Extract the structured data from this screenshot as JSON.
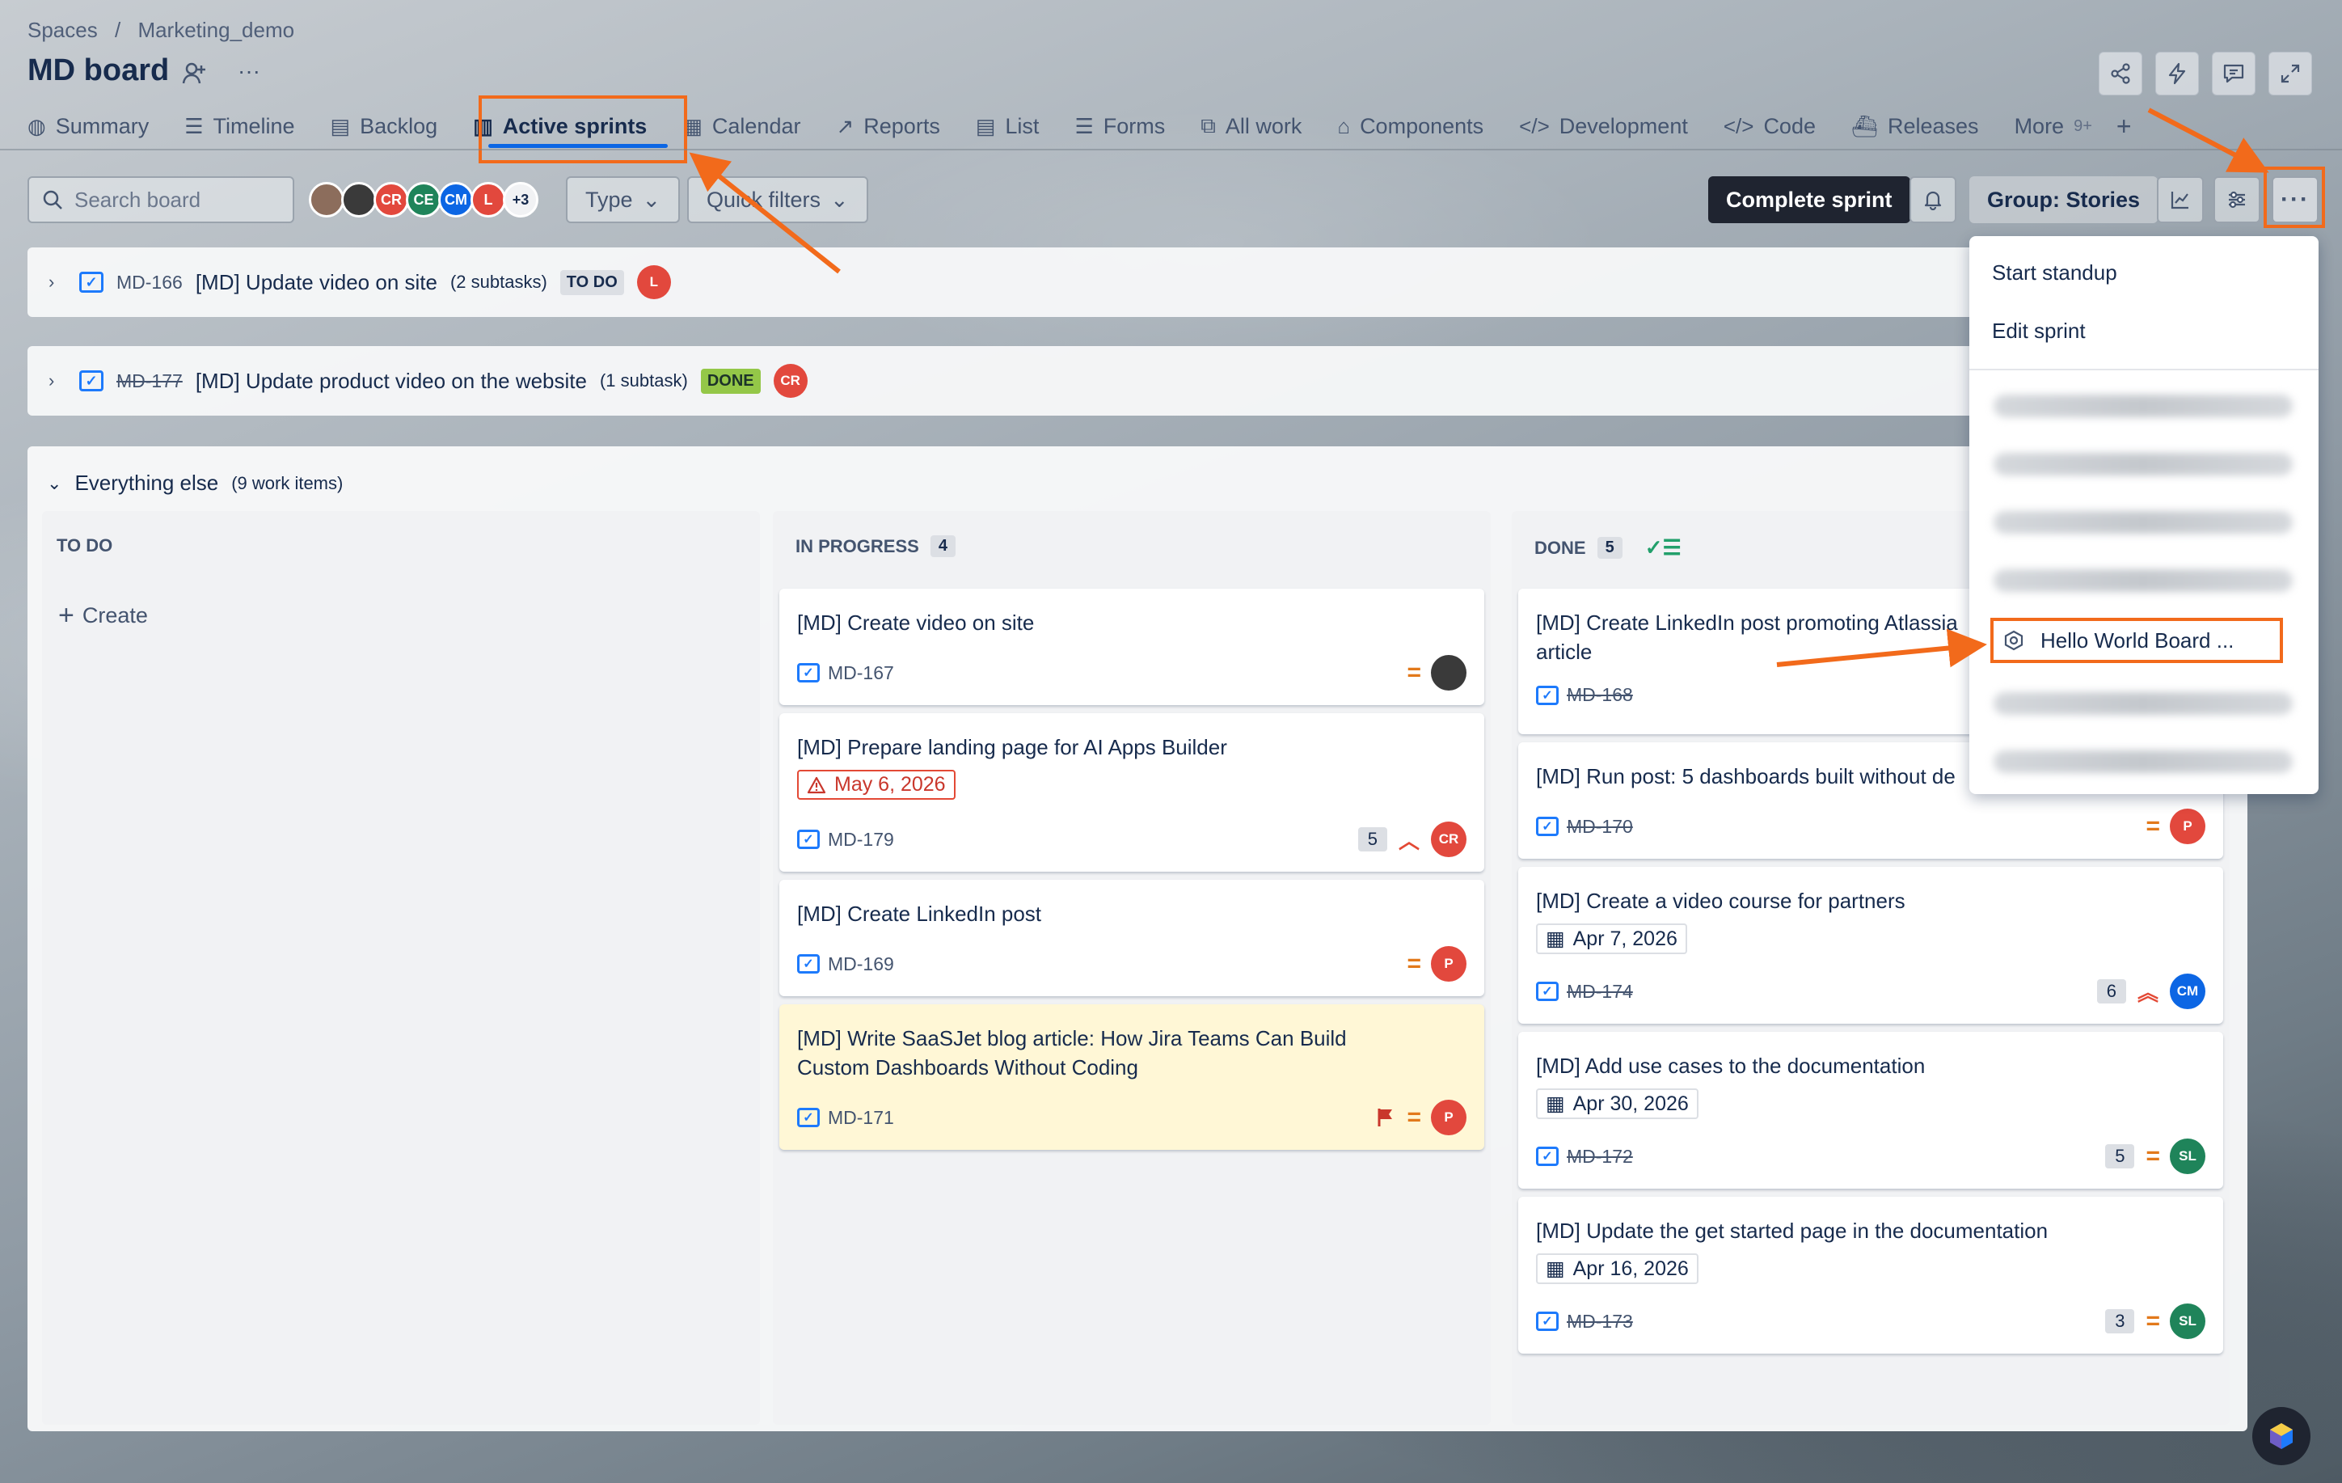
{
  "breadcrumb": {
    "spaces": "Spaces",
    "sep": "/",
    "project": "Marketing_demo"
  },
  "board_title": "MD board",
  "tabs": [
    {
      "label": "Summary",
      "icon": "globe-icon"
    },
    {
      "label": "Timeline",
      "icon": "timeline-icon"
    },
    {
      "label": "Backlog",
      "icon": "backlog-icon"
    },
    {
      "label": "Active sprints",
      "icon": "board-icon"
    },
    {
      "label": "Calendar",
      "icon": "calendar-icon"
    },
    {
      "label": "Reports",
      "icon": "chart-icon"
    },
    {
      "label": "List",
      "icon": "list-icon"
    },
    {
      "label": "Forms",
      "icon": "forms-icon"
    },
    {
      "label": "All work",
      "icon": "all-work-icon"
    },
    {
      "label": "Components",
      "icon": "components-icon"
    },
    {
      "label": "Development",
      "icon": "development-icon"
    },
    {
      "label": "Code",
      "icon": "code-icon"
    },
    {
      "label": "Releases",
      "icon": "releases-icon"
    },
    {
      "label": "More",
      "badge": "9+"
    }
  ],
  "toolbar": {
    "search_placeholder": "Search board",
    "avatars": [
      {
        "initials": "",
        "color": "#8c6d5c"
      },
      {
        "initials": "",
        "color": "#3a3a3a"
      },
      {
        "initials": "CR",
        "color": "#e2483d"
      },
      {
        "initials": "CE",
        "color": "#1f845a"
      },
      {
        "initials": "CM",
        "color": "#0c66e4"
      },
      {
        "initials": "L",
        "color": "#e2483d"
      }
    ],
    "avatars_more": "+3",
    "type_label": "Type",
    "quick_filters_label": "Quick filters",
    "complete_sprint": "Complete sprint",
    "group_label": "Group: Stories"
  },
  "lanes": [
    {
      "key": "MD-166",
      "title": "[MD] Update video on site",
      "subtasks": "(2 subtasks)",
      "status": "TO DO",
      "avatar": "L",
      "avatar_color": "#e2483d"
    },
    {
      "key": "MD-177",
      "title": "[MD] Update product video on the website",
      "subtasks": "(1 subtask)",
      "status": "DONE",
      "avatar": "CR",
      "avatar_color": "#e2483d"
    }
  ],
  "everything_else": {
    "label": "Everything else",
    "count": "(9 work items)"
  },
  "columns": {
    "todo": {
      "title": "TO DO",
      "create": "Create"
    },
    "inprogress": {
      "title": "IN PROGRESS",
      "count": "4"
    },
    "done": {
      "title": "DONE",
      "count": "5"
    }
  },
  "inprogress_cards": [
    {
      "title": "[MD] Create video on site",
      "key": "MD-167",
      "avatar": "",
      "avatar_color": "#3a3a3a"
    },
    {
      "title": "[MD] Prepare landing page for AI Apps Builder",
      "due": "May 6, 2026",
      "key": "MD-179",
      "estimate": "5",
      "avatar": "CR",
      "avatar_color": "#e2483d"
    },
    {
      "title": "[MD] Create LinkedIn post",
      "key": "MD-169",
      "avatar": "P",
      "avatar_color": "#e2483d"
    },
    {
      "title": "[MD] Write SaaSJet blog article: How Jira Teams Can Build Custom Dashboards Without Coding",
      "key": "MD-171",
      "avatar": "P",
      "avatar_color": "#e2483d"
    }
  ],
  "done_cards": [
    {
      "title": "[MD] Create LinkedIn post promoting Atlassia",
      "title2": "article",
      "key": "MD-168"
    },
    {
      "title": "[MD] Run post: 5 dashboards built without de",
      "key": "MD-170",
      "avatar": "P",
      "avatar_color": "#e2483d"
    },
    {
      "title": "[MD] Create a video course for partners",
      "date": "Apr 7, 2026",
      "key": "MD-174",
      "estimate": "6",
      "avatar": "CM",
      "avatar_color": "#0c66e4"
    },
    {
      "title": "[MD] Add use cases to the documentation",
      "date": "Apr 30, 2026",
      "key": "MD-172",
      "estimate": "5",
      "avatar": "SL",
      "avatar_color": "#1f845a"
    },
    {
      "title": "[MD] Update the get started page in the documentation",
      "date": "Apr 16, 2026",
      "key": "MD-173",
      "estimate": "3",
      "avatar": "SL",
      "avatar_color": "#1f845a"
    }
  ],
  "menu": {
    "start_standup": "Start standup",
    "edit_sprint": "Edit sprint",
    "hello_world": "Hello World Board ..."
  },
  "colors": {
    "accent": "#0c66e4",
    "annotation": "#f26a1b"
  }
}
